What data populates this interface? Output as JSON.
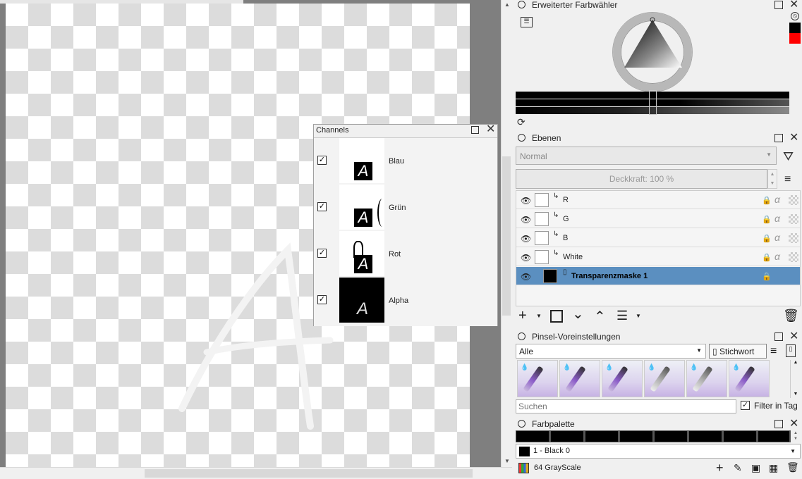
{
  "canvas": {
    "description": "transparent canvas with white letter A stroke"
  },
  "channels": {
    "title": "Channels",
    "items": [
      {
        "label": "Blau",
        "checked": "✓"
      },
      {
        "label": "Grün",
        "checked": "✓"
      },
      {
        "label": "Rot",
        "checked": "✓"
      },
      {
        "label": "Alpha",
        "checked": "✓"
      }
    ]
  },
  "color_selector": {
    "title": "Erweiterter Farbwähler",
    "colors": {
      "fg": "#000000",
      "bg": "#ff0000"
    }
  },
  "layers": {
    "title": "Ebenen",
    "blend_mode": "Normal",
    "opacity_label": "Deckkraft:  100 %",
    "rows": [
      {
        "name": "R",
        "selected": false
      },
      {
        "name": "G",
        "selected": false
      },
      {
        "name": "B",
        "selected": false
      },
      {
        "name": "White",
        "selected": false
      },
      {
        "name": "Transparenzmaske 1",
        "selected": true
      }
    ]
  },
  "brush_presets": {
    "title": "Pinsel-Voreinstellungen",
    "filter": "Alle",
    "tag_button": "Stichwort",
    "search_placeholder": "Suchen",
    "filter_in_tag": "Filter in Tag",
    "count": 6
  },
  "palette": {
    "title": "Farbpalette",
    "selected_color": "1 - Black 0",
    "palette_name": "64 GrayScale"
  }
}
